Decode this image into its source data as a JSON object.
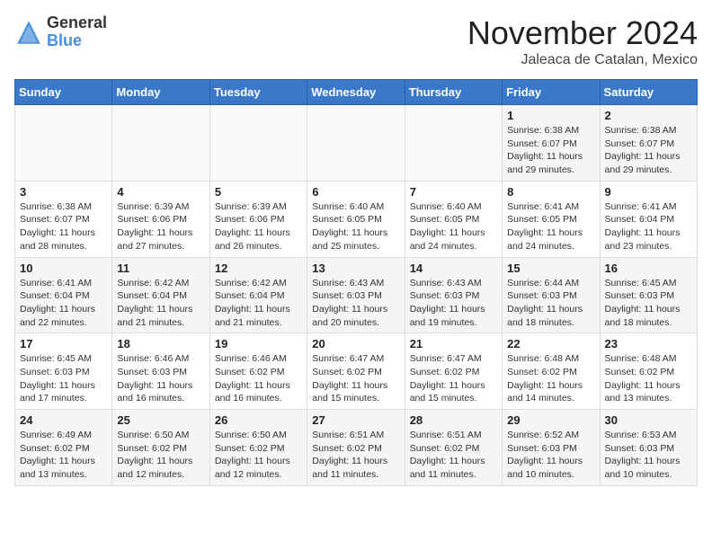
{
  "logo": {
    "general": "General",
    "blue": "Blue"
  },
  "header": {
    "month": "November 2024",
    "location": "Jaleaca de Catalan, Mexico"
  },
  "weekdays": [
    "Sunday",
    "Monday",
    "Tuesday",
    "Wednesday",
    "Thursday",
    "Friday",
    "Saturday"
  ],
  "weeks": [
    [
      {
        "day": "",
        "info": ""
      },
      {
        "day": "",
        "info": ""
      },
      {
        "day": "",
        "info": ""
      },
      {
        "day": "",
        "info": ""
      },
      {
        "day": "",
        "info": ""
      },
      {
        "day": "1",
        "info": "Sunrise: 6:38 AM\nSunset: 6:07 PM\nDaylight: 11 hours and 29 minutes."
      },
      {
        "day": "2",
        "info": "Sunrise: 6:38 AM\nSunset: 6:07 PM\nDaylight: 11 hours and 29 minutes."
      }
    ],
    [
      {
        "day": "3",
        "info": "Sunrise: 6:38 AM\nSunset: 6:07 PM\nDaylight: 11 hours and 28 minutes."
      },
      {
        "day": "4",
        "info": "Sunrise: 6:39 AM\nSunset: 6:06 PM\nDaylight: 11 hours and 27 minutes."
      },
      {
        "day": "5",
        "info": "Sunrise: 6:39 AM\nSunset: 6:06 PM\nDaylight: 11 hours and 26 minutes."
      },
      {
        "day": "6",
        "info": "Sunrise: 6:40 AM\nSunset: 6:05 PM\nDaylight: 11 hours and 25 minutes."
      },
      {
        "day": "7",
        "info": "Sunrise: 6:40 AM\nSunset: 6:05 PM\nDaylight: 11 hours and 24 minutes."
      },
      {
        "day": "8",
        "info": "Sunrise: 6:41 AM\nSunset: 6:05 PM\nDaylight: 11 hours and 24 minutes."
      },
      {
        "day": "9",
        "info": "Sunrise: 6:41 AM\nSunset: 6:04 PM\nDaylight: 11 hours and 23 minutes."
      }
    ],
    [
      {
        "day": "10",
        "info": "Sunrise: 6:41 AM\nSunset: 6:04 PM\nDaylight: 11 hours and 22 minutes."
      },
      {
        "day": "11",
        "info": "Sunrise: 6:42 AM\nSunset: 6:04 PM\nDaylight: 11 hours and 21 minutes."
      },
      {
        "day": "12",
        "info": "Sunrise: 6:42 AM\nSunset: 6:04 PM\nDaylight: 11 hours and 21 minutes."
      },
      {
        "day": "13",
        "info": "Sunrise: 6:43 AM\nSunset: 6:03 PM\nDaylight: 11 hours and 20 minutes."
      },
      {
        "day": "14",
        "info": "Sunrise: 6:43 AM\nSunset: 6:03 PM\nDaylight: 11 hours and 19 minutes."
      },
      {
        "day": "15",
        "info": "Sunrise: 6:44 AM\nSunset: 6:03 PM\nDaylight: 11 hours and 18 minutes."
      },
      {
        "day": "16",
        "info": "Sunrise: 6:45 AM\nSunset: 6:03 PM\nDaylight: 11 hours and 18 minutes."
      }
    ],
    [
      {
        "day": "17",
        "info": "Sunrise: 6:45 AM\nSunset: 6:03 PM\nDaylight: 11 hours and 17 minutes."
      },
      {
        "day": "18",
        "info": "Sunrise: 6:46 AM\nSunset: 6:03 PM\nDaylight: 11 hours and 16 minutes."
      },
      {
        "day": "19",
        "info": "Sunrise: 6:46 AM\nSunset: 6:02 PM\nDaylight: 11 hours and 16 minutes."
      },
      {
        "day": "20",
        "info": "Sunrise: 6:47 AM\nSunset: 6:02 PM\nDaylight: 11 hours and 15 minutes."
      },
      {
        "day": "21",
        "info": "Sunrise: 6:47 AM\nSunset: 6:02 PM\nDaylight: 11 hours and 15 minutes."
      },
      {
        "day": "22",
        "info": "Sunrise: 6:48 AM\nSunset: 6:02 PM\nDaylight: 11 hours and 14 minutes."
      },
      {
        "day": "23",
        "info": "Sunrise: 6:48 AM\nSunset: 6:02 PM\nDaylight: 11 hours and 13 minutes."
      }
    ],
    [
      {
        "day": "24",
        "info": "Sunrise: 6:49 AM\nSunset: 6:02 PM\nDaylight: 11 hours and 13 minutes."
      },
      {
        "day": "25",
        "info": "Sunrise: 6:50 AM\nSunset: 6:02 PM\nDaylight: 11 hours and 12 minutes."
      },
      {
        "day": "26",
        "info": "Sunrise: 6:50 AM\nSunset: 6:02 PM\nDaylight: 11 hours and 12 minutes."
      },
      {
        "day": "27",
        "info": "Sunrise: 6:51 AM\nSunset: 6:02 PM\nDaylight: 11 hours and 11 minutes."
      },
      {
        "day": "28",
        "info": "Sunrise: 6:51 AM\nSunset: 6:02 PM\nDaylight: 11 hours and 11 minutes."
      },
      {
        "day": "29",
        "info": "Sunrise: 6:52 AM\nSunset: 6:03 PM\nDaylight: 11 hours and 10 minutes."
      },
      {
        "day": "30",
        "info": "Sunrise: 6:53 AM\nSunset: 6:03 PM\nDaylight: 11 hours and 10 minutes."
      }
    ]
  ]
}
